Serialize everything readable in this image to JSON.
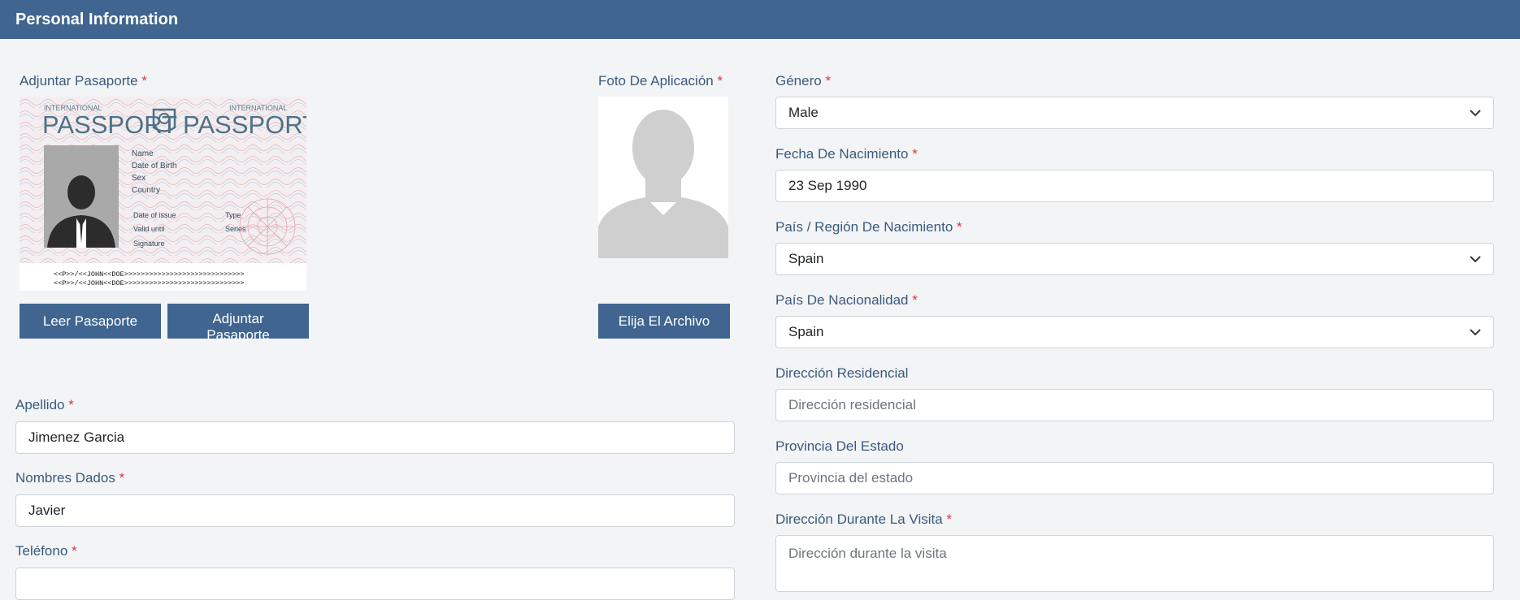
{
  "header": {
    "title": "Personal Information"
  },
  "passport_upload": {
    "label": "Adjuntar Pasaporte",
    "required": "*",
    "image": {
      "left_title_small": "INTERNATIONAL",
      "left_title": "PASSPORT",
      "right_title_small": "INTERNATIONAL",
      "right_title": "PASSPORT",
      "fields": [
        "Name",
        "Date of Birth",
        "Sex",
        "Country"
      ],
      "dates": [
        "Date of issue",
        "Valid until",
        "Signature"
      ],
      "extra": [
        "Type",
        "Series"
      ],
      "mrz_line1": "<<P>>/<<JOHN<<DOE>>>>>>>>>>>>>>>>>>>>>>>>>>>>>",
      "mrz_line2": "<<P>>/<<JOHN<<DOE>>>>>>>>>>>>>>>>>>>>>>>>>>>>>"
    },
    "read_button": "Leer Pasaporte",
    "attach_button": "Adjuntar Pasaporte"
  },
  "photo_upload": {
    "label": "Foto De Aplicación",
    "required": "*",
    "choose_button": "Elija El Archivo"
  },
  "left_fields": {
    "apellido": {
      "label": "Apellido",
      "required": "*",
      "value": "Jimenez Garcia"
    },
    "nombres": {
      "label": "Nombres Dados",
      "required": "*",
      "value": "Javier"
    },
    "telefono": {
      "label": "Teléfono",
      "required": "*",
      "value": ""
    }
  },
  "right_fields": {
    "genero": {
      "label": "Género",
      "required": "*",
      "value": "Male"
    },
    "fecha": {
      "label": "Fecha De Nacimiento",
      "required": "*",
      "value": "23 Sep 1990"
    },
    "pais_nacimiento": {
      "label": "País / Región De Nacimiento",
      "required": "*",
      "value": "Spain"
    },
    "nacionalidad": {
      "label": "País De Nacionalidad",
      "required": "*",
      "value": "Spain"
    },
    "direccion": {
      "label": "Dirección Residencial",
      "placeholder": "Dirección residencial"
    },
    "provincia": {
      "label": "Provincia Del Estado",
      "placeholder": "Provincia del estado"
    },
    "direccion_visita": {
      "label": "Dirección Durante La Visita",
      "required": "*",
      "placeholder": "Dirección durante la visita"
    }
  },
  "icons": {
    "dropdown": "chevron-down-icon",
    "avatar": "person-silhouette-icon",
    "emblem": "passport-emblem-icon"
  },
  "colors": {
    "header": "#3f6590",
    "button": "#3f6590",
    "required": "#dc3545",
    "label": "#3b5a7d"
  }
}
